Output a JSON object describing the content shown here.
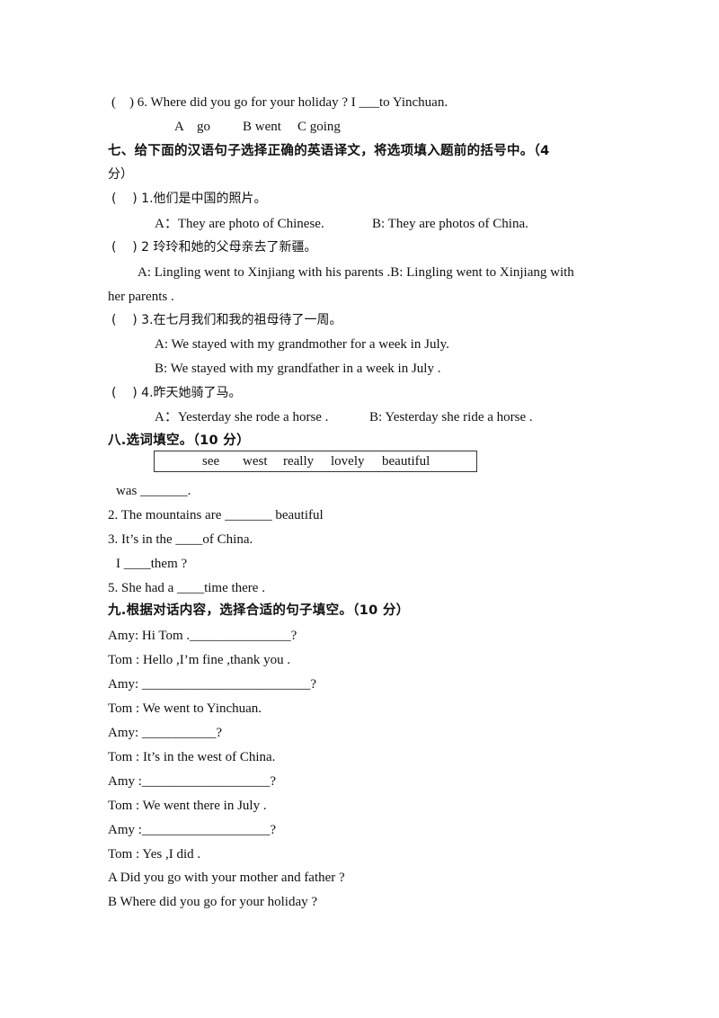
{
  "q6": {
    "prefix": "(    ) 6. Where did you go for your holiday ? I ___to Yinchuan.",
    "options": [
      "A    go",
      "B went",
      "C going"
    ]
  },
  "section7": {
    "title": "七、给下面的汉语句子选择正确的英语译文，将选项填入题前的括号中。（4",
    "title_cont": "分）",
    "items": [
      {
        "stem": "(    ) 1.他们是中国的照片。",
        "option_a": "A：They are photo of Chinese.",
        "option_b": "B: They are photos of China."
      },
      {
        "stem": "(    ) 2 玲玲和她的父母亲去了新疆。",
        "option_a": "A: Lingling went to Xinjiang with his parents .B: Lingling went to Xinjiang with",
        "option_b": "her parents ."
      },
      {
        "stem": "(    ) 3.在七月我们和我的祖母待了一周。",
        "option_a": "A: We stayed with my grandmother for a week in July.",
        "option_b": "B: We stayed with my grandfather in a week in July ."
      },
      {
        "stem": "(    ) 4.昨天她骑了马。",
        "option_a": "A：Yesterday she rode a horse .",
        "option_b": "B: Yesterday she ride a horse ."
      }
    ]
  },
  "section8": {
    "title": "八.选词填空。（10 分）",
    "word_bank": [
      "see",
      "west",
      "really",
      "lovely",
      "beautiful"
    ],
    "items": [
      "was _______.",
      "2. The mountains are _______ beautiful",
      "3. It’s in the ____of China.",
      "I ____them ?",
      "5. She had a ____time there ."
    ]
  },
  "section9": {
    "title": "九.根据对话内容，选择合适的句子填空。（10 分）",
    "dialogue": [
      "Amy: Hi Tom ._______________?",
      "Tom : Hello ,I’m fine ,thank you .",
      "Amy: _________________________?",
      "Tom : We went to Yinchuan.",
      "Amy: ___________?",
      "Tom : It’s in the west of China.",
      "Amy :___________________?",
      "Tom : We went there in July .",
      "Amy :___________________?",
      "Tom : Yes ,I did ."
    ],
    "choices": [
      "A Did you go with your mother and father ?",
      "B Where did you go for your holiday ?"
    ]
  }
}
